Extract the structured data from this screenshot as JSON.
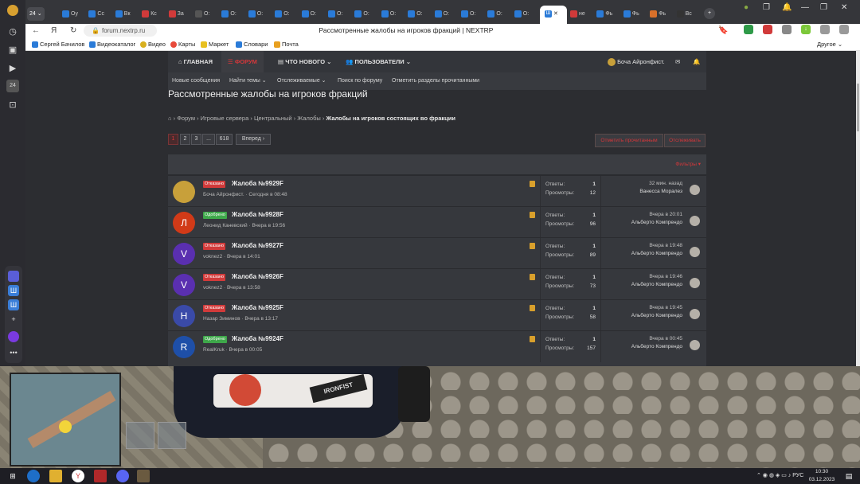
{
  "browser": {
    "tab_count": "24",
    "tabs": [
      "Оу",
      "Сс",
      "Вк",
      "Кс",
      "За",
      "О:",
      "О:",
      "О:",
      "О:",
      "О:",
      "О:",
      "О:",
      "О:",
      "О:",
      "О:",
      "О:",
      "О:",
      "О:"
    ],
    "active_tab_icon": "Ш",
    "extra_tabs": [
      "не",
      "Фь",
      "Фь",
      "Фь",
      "Вс"
    ],
    "address": "forum.nextrp.ru",
    "page_title": "Рассмотренные жалобы на игроков фракций | NEXTRP",
    "bookmarks": [
      "Сергей Бачилов",
      "Видеокаталог",
      "Видео",
      "Карты",
      "Маркет",
      "Словари",
      "Почта"
    ],
    "bookmarks_other": "Другое"
  },
  "site": {
    "nav": {
      "home": "Главная",
      "forums": "Форум",
      "whats_new": "Что нового",
      "members": "Пользователи",
      "user": "Боча Айронфист."
    },
    "subnav": [
      "Новые сообщения",
      "Найти темы",
      "Отслеживаемые",
      "Поиск по форуму",
      "Отметить разделы прочитанными"
    ],
    "page_title": "Рассмотренные жалобы на игроков фракций",
    "breadcrumb": [
      "Форум",
      "Игровые сервера",
      "Центральный",
      "Жалобы"
    ],
    "breadcrumb_current": "Жалобы на игроков состоящих во фракции",
    "pagination": [
      "1",
      "2",
      "3",
      "...",
      "618"
    ],
    "next": "Вперед",
    "mark_read": "Отметить прочитанным",
    "watch": "Отслеживать",
    "filters": "Фильтры",
    "labels": {
      "replies": "Ответы:",
      "views": "Просмотры:"
    },
    "threads": [
      {
        "status": "Отказано",
        "status_color": "#d13a3a",
        "title": "Жалоба №9929F",
        "author": "Боча Айронфист.",
        "date": "Сегодня в 08:48",
        "replies": "1",
        "views": "12",
        "last_time": "32 мин. назад",
        "last_user": "Ванесса Моралез",
        "avatar": "",
        "avatar_color": "#c8a03a"
      },
      {
        "status": "Одобрено",
        "status_color": "#3ea84a",
        "title": "Жалоба №9928F",
        "author": "Леонид Каневский",
        "date": "Вчера в 19:56",
        "replies": "1",
        "views": "96",
        "last_time": "Вчера в 20:01",
        "last_user": "Альберто Компрендо",
        "avatar": "Л",
        "avatar_color": "#d13a18"
      },
      {
        "status": "Отказано",
        "status_color": "#d13a3a",
        "title": "Жалоба №9927F",
        "author": "voknez2",
        "date": "Вчера в 14:01",
        "replies": "1",
        "views": "89",
        "last_time": "Вчера в 19:48",
        "last_user": "Альберто Компрендо",
        "avatar": "V",
        "avatar_color": "#5a2fb0"
      },
      {
        "status": "Отказано",
        "status_color": "#d13a3a",
        "title": "Жалоба №9926F",
        "author": "voknez2",
        "date": "Вчера в 13:58",
        "replies": "1",
        "views": "73",
        "last_time": "Вчера в 19:46",
        "last_user": "Альберто Компрендо",
        "avatar": "V",
        "avatar_color": "#5a2fb0"
      },
      {
        "status": "Отказано",
        "status_color": "#d13a3a",
        "title": "Жалоба №9925F",
        "author": "Назар Зиминов",
        "date": "Вчера в 13:17",
        "replies": "1",
        "views": "58",
        "last_time": "Вчера в 19:45",
        "last_user": "Альберто Компрендо",
        "avatar": "Н",
        "avatar_color": "#3a4aa8"
      },
      {
        "status": "Одобрено",
        "status_color": "#3ea84a",
        "title": "Жалоба №9924F",
        "author": "RealKruk",
        "date": "Вчера в 00:05",
        "replies": "1",
        "views": "157",
        "last_time": "Вчера в 00:45",
        "last_user": "Альберто Компрендо",
        "avatar": "R",
        "avatar_color": "#1e4fa8"
      }
    ]
  },
  "game": {
    "car_sign": "IRONFIST"
  },
  "taskbar": {
    "lang": "РУС",
    "time": "10:30",
    "date": "03.12.2023"
  }
}
